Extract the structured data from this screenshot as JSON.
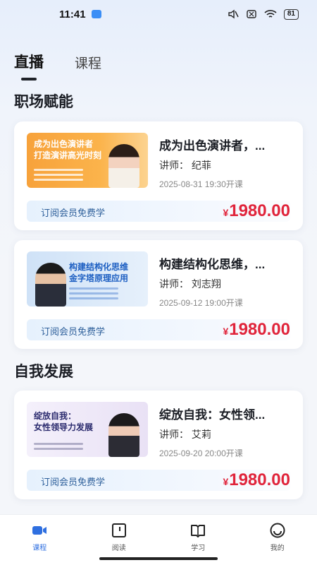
{
  "status_bar": {
    "time": "11:41",
    "battery": "81"
  },
  "tabs": [
    {
      "label": "直播",
      "active": true
    },
    {
      "label": "课程",
      "active": false
    }
  ],
  "sections": [
    {
      "title": "职场赋能"
    },
    {
      "title": "自我发展"
    }
  ],
  "courses": [
    {
      "thumb_text": "成为出色演讲者\n打造演讲高光时刻",
      "title": "成为出色演讲者，...",
      "teacher": "讲师：  纪菲",
      "time": "2025-08-31 19:30开课",
      "subscribe_label": "订阅会员免费学",
      "currency": "¥",
      "price": "1980.00"
    },
    {
      "thumb_text": "构建结构化思维\n金字塔原理应用",
      "title": "构建结构化思维，...",
      "teacher": "讲师：  刘志翔",
      "time": "2025-09-12 19:00开课",
      "subscribe_label": "订阅会员免费学",
      "currency": "¥",
      "price": "1980.00"
    },
    {
      "thumb_text": "绽放自我：\n女性领导力发展",
      "title": "绽放自我：女性领...",
      "teacher": "讲师：  艾莉",
      "time": "2025-09-20 20:00开课",
      "subscribe_label": "订阅会员免费学",
      "currency": "¥",
      "price": "1980.00"
    }
  ],
  "bottom_nav": [
    {
      "label": "课程",
      "icon": "video-camera-icon",
      "active": true
    },
    {
      "label": "阅读",
      "icon": "read-icon",
      "active": false
    },
    {
      "label": "学习",
      "icon": "book-icon",
      "active": false
    },
    {
      "label": "我的",
      "icon": "profile-icon",
      "active": false
    }
  ],
  "colors": {
    "accent": "#2f6fe0",
    "price": "#e0243b"
  }
}
